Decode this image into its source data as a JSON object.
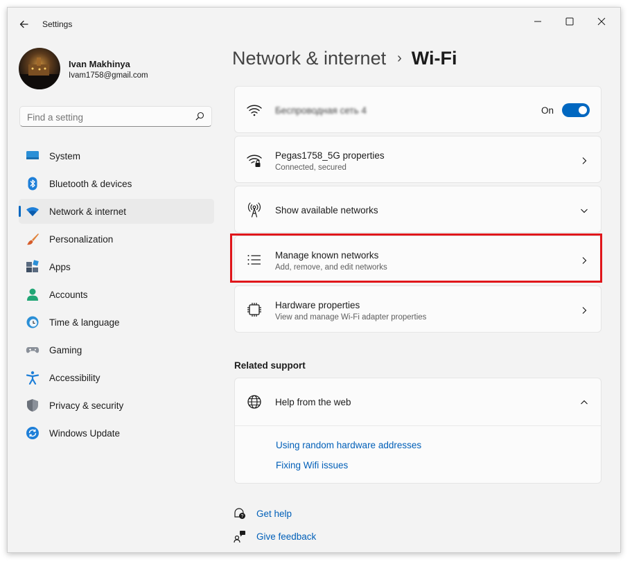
{
  "app": {
    "title": "Settings"
  },
  "window_controls": {
    "minimize": "minimize-icon",
    "maximize": "maximize-icon",
    "close": "close-icon"
  },
  "user": {
    "name": "Ivan Makhinya",
    "email": "Ivam1758@gmail.com"
  },
  "search": {
    "placeholder": "Find a setting"
  },
  "sidebar": {
    "items": [
      {
        "label": "System",
        "icon": "system-icon"
      },
      {
        "label": "Bluetooth & devices",
        "icon": "bluetooth-icon"
      },
      {
        "label": "Network & internet",
        "icon": "wifi-icon",
        "active": true
      },
      {
        "label": "Personalization",
        "icon": "brush-icon"
      },
      {
        "label": "Apps",
        "icon": "apps-icon"
      },
      {
        "label": "Accounts",
        "icon": "accounts-icon"
      },
      {
        "label": "Time & language",
        "icon": "clock-globe-icon"
      },
      {
        "label": "Gaming",
        "icon": "gamepad-icon"
      },
      {
        "label": "Accessibility",
        "icon": "accessibility-icon"
      },
      {
        "label": "Privacy & security",
        "icon": "shield-icon"
      },
      {
        "label": "Windows Update",
        "icon": "update-icon"
      }
    ]
  },
  "breadcrumb": {
    "parent": "Network & internet",
    "separator": "›",
    "current": "Wi-Fi"
  },
  "wifi": {
    "name": "Беспроводная сеть 4",
    "toggle_label": "On",
    "enabled": true
  },
  "rows": {
    "properties": {
      "title": "Pegas1758_5G properties",
      "subtitle": "Connected, secured"
    },
    "show_networks": {
      "title": "Show available networks"
    },
    "manage_known": {
      "title": "Manage known networks",
      "subtitle": "Add, remove, and edit networks"
    },
    "hardware": {
      "title": "Hardware properties",
      "subtitle": "View and manage Wi-Fi adapter properties"
    }
  },
  "related_support": {
    "title": "Related support",
    "help_title": "Help from the web",
    "links": [
      "Using random hardware addresses",
      "Fixing Wifi issues"
    ]
  },
  "footer": {
    "get_help": "Get help",
    "give_feedback": "Give feedback"
  },
  "colors": {
    "accent": "#0067c0",
    "link": "#005fb8",
    "highlight": "#e0161b"
  }
}
